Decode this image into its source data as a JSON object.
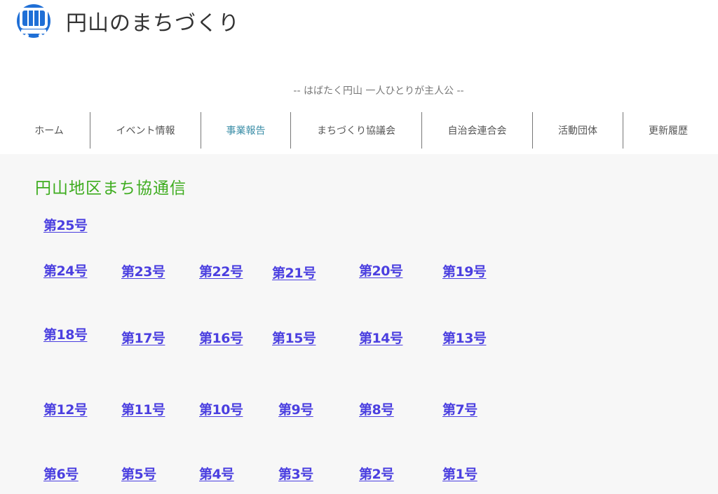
{
  "site": {
    "title": "円山のまちづくり",
    "tagline": "-- はばたく円山 一人ひとりが主人公 --",
    "logo_icon": "tram-icon",
    "logo_color": "#1f6fd6"
  },
  "nav": {
    "items": [
      {
        "label": "ホーム"
      },
      {
        "label": "イベント情報"
      },
      {
        "label": "事業報告",
        "active": true
      },
      {
        "label": "まちづくり協議会"
      },
      {
        "label": "自治会連合会"
      },
      {
        "label": "活動団体"
      },
      {
        "label": "更新履歴"
      }
    ],
    "active_color": "#3d8fa8"
  },
  "main": {
    "section_title": "円山地区まち協通信",
    "title_color": "#3dac1e",
    "link_color": "#4b3fe0",
    "issues": [
      "第25号",
      "第24号",
      "第23号",
      "第22号",
      "第21号",
      "第20号",
      "第19号",
      "第18号",
      "第17号",
      "第16号",
      "第15号",
      "第14号",
      "第13号",
      "第12号",
      "第11号",
      "第10号",
      "第9号",
      "第8号",
      "第7号",
      "第6号",
      "第5号",
      "第4号",
      "第3号",
      "第2号",
      "第1号"
    ]
  }
}
